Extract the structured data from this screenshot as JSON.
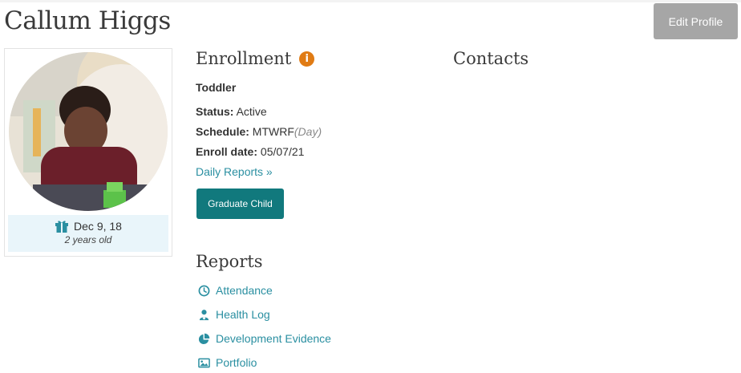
{
  "child": {
    "name": "Callum Higgs",
    "dob": "Dec 9, 18",
    "age": "2 years old"
  },
  "actions": {
    "edit_profile": "Edit Profile",
    "graduate": "Graduate Child"
  },
  "enrollment": {
    "title": "Enrollment",
    "info_icon": "i",
    "room": "Toddler",
    "status_label": "Status:",
    "status_value": "Active",
    "schedule_label": "Schedule:",
    "schedule_value": "MTWRF",
    "schedule_note": "(Day)",
    "enroll_date_label": "Enroll date:",
    "enroll_date_value": "05/07/21",
    "daily_reports_link": "Daily Reports »"
  },
  "contacts": {
    "title": "Contacts"
  },
  "reports": {
    "title": "Reports",
    "items": [
      {
        "label": "Attendance",
        "icon": "clock-icon"
      },
      {
        "label": "Health Log",
        "icon": "user-medical-icon"
      },
      {
        "label": "Development Evidence",
        "icon": "pie-chart-icon"
      },
      {
        "label": "Portfolio",
        "icon": "image-icon"
      }
    ]
  },
  "colors": {
    "accent": "#2a8fa1",
    "primary_button": "#11797d",
    "secondary_button": "#a6a6a6",
    "info": "#e07b14",
    "dob_background": "#e9f5fa"
  }
}
